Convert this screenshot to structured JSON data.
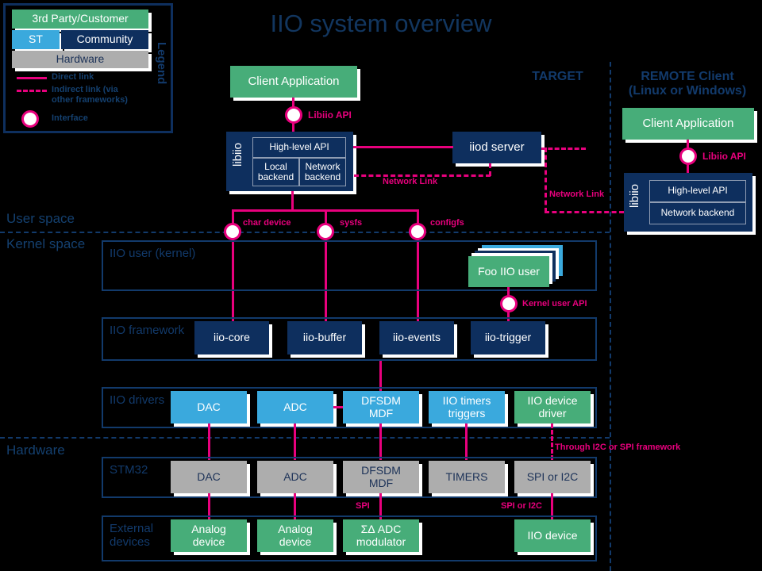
{
  "title": "IIO system overview",
  "legend": {
    "vertical_label": "Legend",
    "chips": [
      {
        "label": "3rd Party/Customer",
        "color": "#47ad79"
      },
      {
        "label": "ST",
        "color": "#3aa9dd"
      },
      {
        "label": "Community",
        "color": "#0e2f5e"
      },
      {
        "label": "Hardware",
        "color": "#adadad"
      }
    ],
    "keys": [
      {
        "label": "Direct link",
        "style": "solid"
      },
      {
        "label": "Indirect link (via\nother frameworks)",
        "style": "dashed"
      },
      {
        "label": "Interface",
        "style": "circle"
      }
    ]
  },
  "zones": {
    "target": "TARGET",
    "remote": "REMOTE Client\n(Linux or Windows)",
    "user_space": "User space",
    "kernel_space": "Kernel space",
    "hardware": "Hardware"
  },
  "target": {
    "client_application": "Client Application",
    "libiio_label": "libiio",
    "libiio_blocks": {
      "high_level_api": "High-level API",
      "local_backend": "Local\nbackend",
      "network_backend": "Network\nbackend"
    },
    "iiod_server": "iiod server"
  },
  "remote": {
    "client_application": "Client Application",
    "libiio_label": "libiio",
    "libiio_blocks": {
      "high_level_api": "High-level API",
      "network_backend": "Network backend"
    }
  },
  "interfaces": {
    "libiio_api_target": "Libiio API",
    "libiio_api_remote": "Libiio API",
    "char_device": "char device",
    "sysfs": "sysfs",
    "configfs": "configfs",
    "kernel_user_api": "Kernel user API"
  },
  "links": {
    "network_link_left": "Network Link",
    "network_link_right": "Network Link",
    "through_i2c_spi": "Through I2C or SPI framework",
    "spi": "SPI",
    "spi_or_i2c": "SPI or I2C"
  },
  "rows": {
    "iio_user_kernel": {
      "label": "IIO user (kernel)",
      "items": [
        {
          "label": "Foo IIO user",
          "color": "#47ad79",
          "stacked": true
        }
      ]
    },
    "iio_framework": {
      "label": "IIO framework",
      "items": [
        {
          "label": "iio-core",
          "color": "#0e2f5e"
        },
        {
          "label": "iio-buffer",
          "color": "#0e2f5e"
        },
        {
          "label": "iio-events",
          "color": "#0e2f5e"
        },
        {
          "label": "iio-trigger",
          "color": "#0e2f5e"
        }
      ]
    },
    "iio_drivers": {
      "label": "IIO drivers",
      "items": [
        {
          "label": "DAC",
          "color": "#3aa9dd"
        },
        {
          "label": "ADC",
          "color": "#3aa9dd"
        },
        {
          "label": "DFSDM\nMDF",
          "color": "#3aa9dd"
        },
        {
          "label": "IIO timers\ntriggers",
          "color": "#3aa9dd"
        },
        {
          "label": "IIO device\ndriver",
          "color": "#47ad79"
        }
      ]
    },
    "stm32": {
      "label": "STM32",
      "items": [
        {
          "label": "DAC",
          "color": "#adadad"
        },
        {
          "label": "ADC",
          "color": "#adadad"
        },
        {
          "label": "DFSDM\nMDF",
          "color": "#adadad"
        },
        {
          "label": "TIMERS",
          "color": "#adadad"
        },
        {
          "label": "SPI or I2C",
          "color": "#adadad"
        }
      ]
    },
    "external_devices": {
      "label": "External\ndevices",
      "items": [
        {
          "label": "Analog\ndevice",
          "color": "#47ad79"
        },
        {
          "label": "Analog\ndevice",
          "color": "#47ad79"
        },
        {
          "label": "ΣΔ ADC\nmodulator",
          "color": "#47ad79"
        },
        {
          "label": "IIO device",
          "color": "#47ad79"
        }
      ]
    }
  },
  "colors": {
    "green": "#47ad79",
    "navy": "#0e2f5e",
    "light_blue": "#3aa9dd",
    "grey": "#adadad",
    "pink": "#e8007d",
    "frame_blue": "#123a6b",
    "background": "#000000"
  }
}
